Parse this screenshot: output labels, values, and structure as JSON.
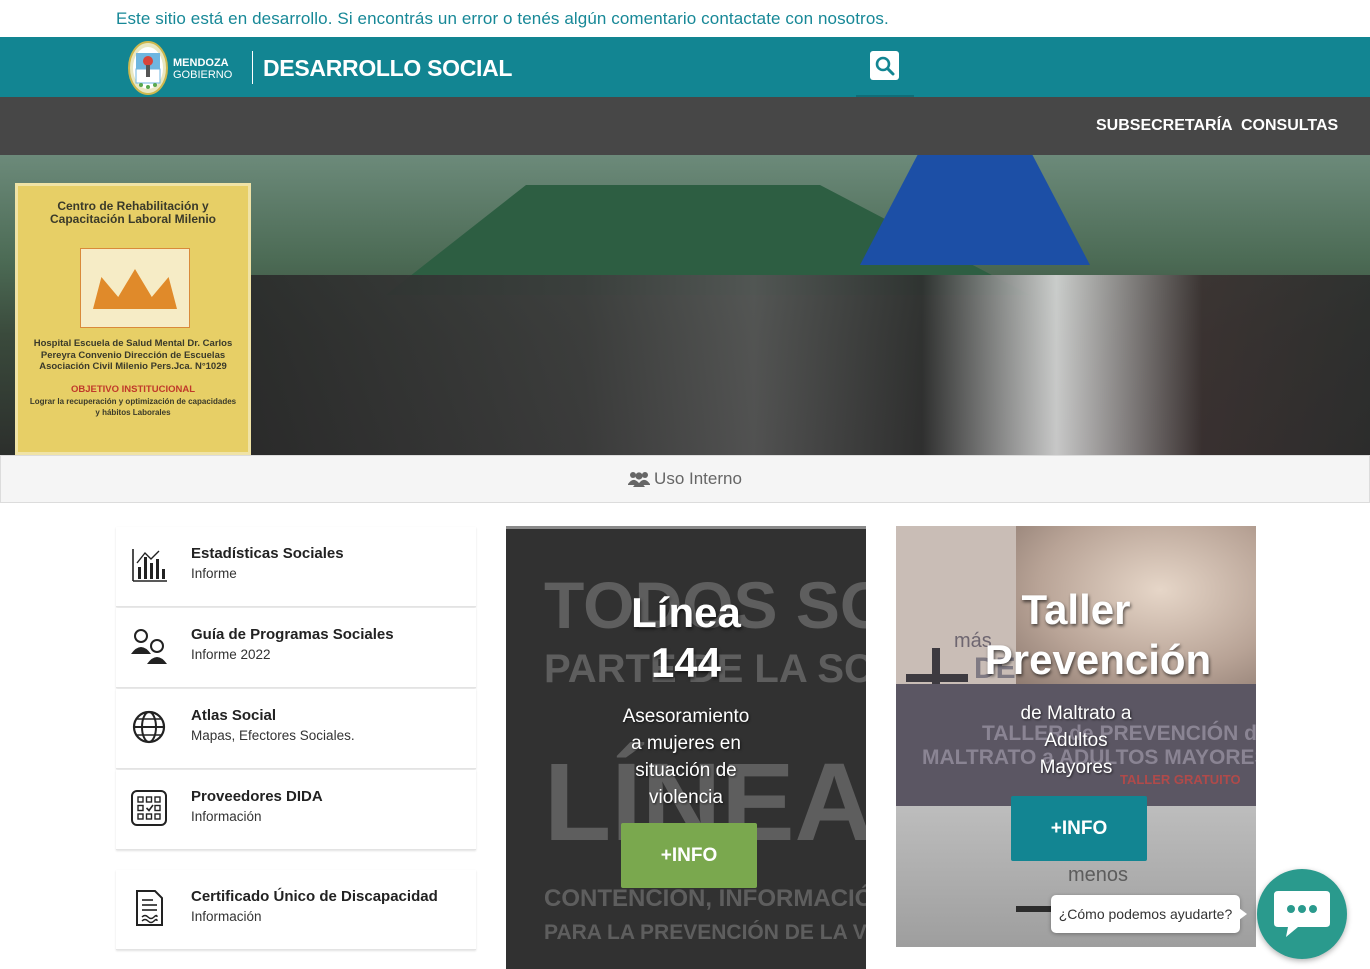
{
  "dev_banner": {
    "text": "Este sitio está en desarrollo. Si encontrás un error o tenés algún comentario contactate con nosotros."
  },
  "header": {
    "logo_line1": "MENDOZA",
    "logo_line2": "GOBIERNO",
    "site_title": "DESARROLLO SOCIAL",
    "search_icon": "search-icon",
    "bg_color": "#128592"
  },
  "nav": {
    "items": [
      "SUBSECRETARÍA",
      "CONSULTAS"
    ],
    "bg_color": "#474747"
  },
  "hero": {
    "poster_title": "Centro de Rehabilitación y Capacitación Laboral Milenio",
    "poster_body": "Hospital Escuela de Salud Mental Dr. Carlos Pereyra Convenio Dirección de Escuelas Asociación Civil Milenio Pers.Jca. N°1029",
    "poster_footer_1": "OBJETIVO INSTITUCIONAL",
    "poster_footer_2": "Lograr la recuperación y optimización de capacidades y hábitos Laborales"
  },
  "internal": {
    "label": "Uso Interno",
    "icon": "users-icon"
  },
  "links": [
    {
      "title": "Estadísticas Sociales",
      "subtitle": "Informe",
      "icon": "bar-chart-icon"
    },
    {
      "title": "Guía de Programas Sociales",
      "subtitle": "Informe 2022",
      "icon": "people-icon"
    },
    {
      "title": "Atlas Social",
      "subtitle": "Mapas, Efectores Sociales.",
      "icon": "globe-icon"
    },
    {
      "title": "Proveedores DIDA",
      "subtitle": "Información",
      "icon": "checklist-icon"
    },
    {
      "title": "Certificado Único de Discapacidad",
      "subtitle": "Información",
      "icon": "document-icon"
    }
  ],
  "cards": [
    {
      "title_1": "Línea",
      "title_2": "144",
      "desc_lines": [
        "Asesoramiento",
        "a mujeres en",
        "situación de",
        "violencia"
      ],
      "button": "+INFO",
      "button_color": "#7aa84e",
      "bg_lines": [
        "TODOS SO",
        "PARTE DE LA SO",
        "LÍNEA",
        "CONTENCIÓN, INFORMACIÓN",
        "PARA LA PREVENCIÓN DE LA VIO"
      ]
    },
    {
      "title_1": "Taller",
      "title_2": "Prevención",
      "desc_lines": [
        "de Maltrato a",
        "Adultos",
        "Mayores"
      ],
      "button": "+INFO",
      "button_color": "#128592",
      "bg_lines": [
        "más",
        "DE",
        "TALLER de PREVENCIÓN de",
        "MALTRATO a ADULTOS MAYORES",
        "TALLER GRATUITO",
        "menos"
      ]
    }
  ],
  "chat": {
    "prompt": "¿Cómo podemos ayudarte?",
    "icon": "chat-icon",
    "color": "#2a9a8d"
  }
}
